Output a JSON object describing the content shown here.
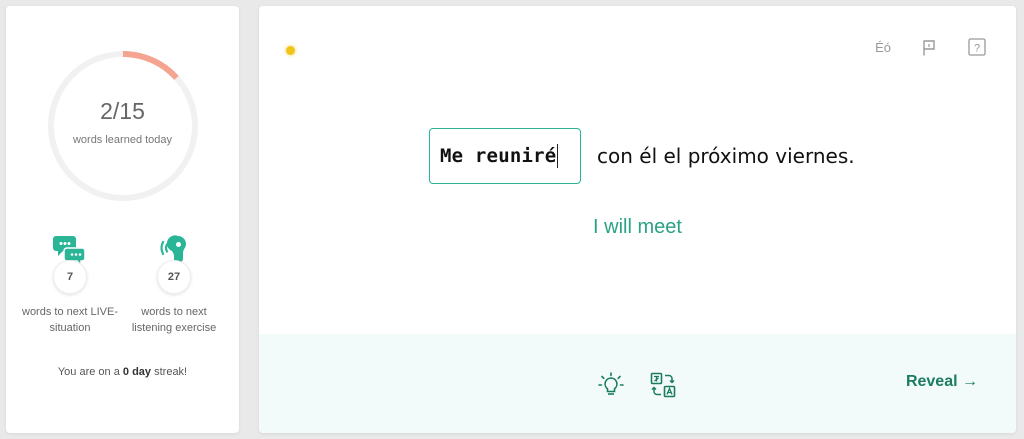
{
  "progress": {
    "count": "2/15",
    "label": "words learned today",
    "fraction": 0.1333,
    "accent_color": "#f4a490"
  },
  "stats": {
    "live": {
      "icon": "chat-bubbles-icon",
      "value": "7",
      "label": "words to next LIVE-situation"
    },
    "listening": {
      "icon": "listening-ear-icon",
      "value": "27",
      "label": "words to next listening exercise"
    }
  },
  "streak": {
    "prefix": "You are on a ",
    "days": "0 day",
    "suffix": " streak!"
  },
  "toolbar": {
    "accents_label": "Éó",
    "flag_icon": "flag-icon",
    "help_label": "?"
  },
  "exercise": {
    "answer_value": "Me reuniré",
    "sentence_rest": "con él el próximo viernes.",
    "translation": "I will meet",
    "status_color": "#f0c419"
  },
  "footer": {
    "hint_icon": "lightbulb-icon",
    "translate_icon": "translate-icon",
    "reveal_label": "Reveal →"
  }
}
